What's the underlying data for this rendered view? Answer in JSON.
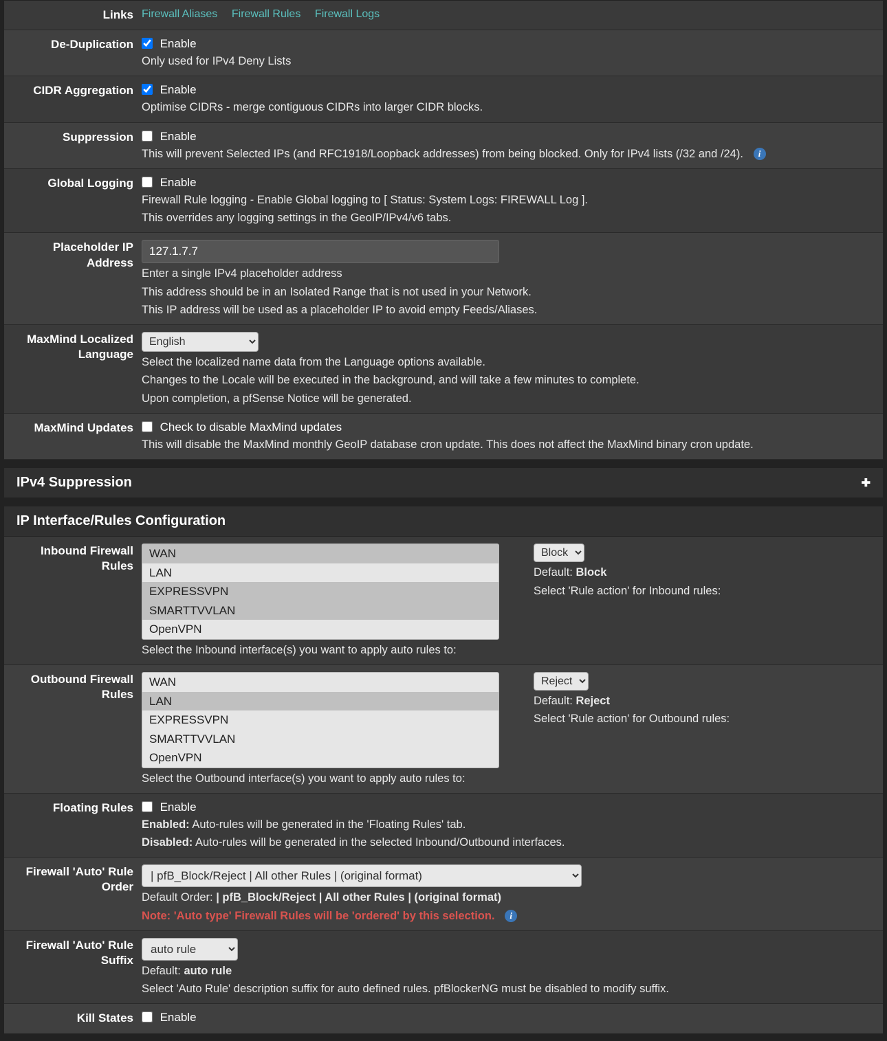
{
  "config": {
    "links": {
      "label": "Links",
      "items": [
        "Firewall Aliases",
        "Firewall Rules",
        "Firewall Logs"
      ]
    },
    "dedup": {
      "label": "De-Duplication",
      "enable": "Enable",
      "checked": true,
      "help": "Only used for IPv4 Deny Lists"
    },
    "cidr": {
      "label": "CIDR Aggregation",
      "enable": "Enable",
      "checked": true,
      "help": "Optimise CIDRs - merge contiguous CIDRs into larger CIDR blocks."
    },
    "suppression": {
      "label": "Suppression",
      "enable": "Enable",
      "checked": false,
      "help": "This will prevent Selected IPs (and RFC1918/Loopback addresses) from being blocked. Only for IPv4 lists (/32 and /24)."
    },
    "globallog": {
      "label": "Global Logging",
      "enable": "Enable",
      "checked": false,
      "help1": "Firewall Rule logging - Enable Global logging to [ Status: System Logs: FIREWALL Log ].",
      "help2": "This overrides any logging settings in the GeoIP/IPv4/v6 tabs."
    },
    "placeholder": {
      "label": "Placeholder IP Address",
      "value": "127.1.7.7",
      "help1": "Enter a single IPv4 placeholder address",
      "help2": "This address should be in an Isolated Range that is not used in your Network.",
      "help3": "This IP address will be used as a placeholder IP to avoid empty Feeds/Aliases."
    },
    "maxmindlang": {
      "label": "MaxMind Localized Language",
      "value": "English",
      "help1": "Select the localized name data from the Language options available.",
      "help2": "Changes to the Locale will be executed in the background, and will take a few minutes to complete.",
      "help3": "Upon completion, a pfSense Notice will be generated."
    },
    "maxmindupd": {
      "label": "MaxMind Updates",
      "enable": "Check to disable MaxMind updates",
      "checked": false,
      "help": "This will disable the MaxMind monthly GeoIP database cron update. This does not affect the MaxMind binary cron update."
    }
  },
  "ipv4supp": {
    "title": "IPv4 Suppression"
  },
  "iprules": {
    "title": "IP Interface/Rules Configuration",
    "inbound": {
      "label": "Inbound Firewall Rules",
      "options": [
        "WAN",
        "LAN",
        "EXPRESSVPN",
        "SMARTTVVLAN",
        "OpenVPN"
      ],
      "selected": [
        0,
        2,
        3
      ],
      "action": "Block",
      "default_prefix": "Default: ",
      "default": "Block",
      "help_action": "Select 'Rule action' for Inbound rules:",
      "help": "Select the Inbound interface(s) you want to apply auto rules to:"
    },
    "outbound": {
      "label": "Outbound Firewall Rules",
      "options": [
        "WAN",
        "LAN",
        "EXPRESSVPN",
        "SMARTTVVLAN",
        "OpenVPN"
      ],
      "selected": [
        1
      ],
      "action": "Reject",
      "default_prefix": "Default: ",
      "default": "Reject",
      "help_action": "Select 'Rule action' for Outbound rules:",
      "help": "Select the Outbound interface(s) you want to apply auto rules to:"
    },
    "floating": {
      "label": "Floating Rules",
      "enable": "Enable",
      "checked": false,
      "enabled_label": "Enabled:",
      "enabled_text": " Auto-rules will be generated in the 'Floating Rules' tab.",
      "disabled_label": "Disabled:",
      "disabled_text": " Auto-rules will be generated in the selected Inbound/Outbound interfaces."
    },
    "ruleorder": {
      "label": "Firewall 'Auto' Rule Order",
      "value": "| pfB_Block/Reject | All other Rules | (original format)",
      "default_prefix": "Default Order: ",
      "default": "| pfB_Block/Reject | All other Rules | (original format)",
      "note": "Note: 'Auto type' Firewall Rules will be 'ordered' by this selection."
    },
    "rulesuffix": {
      "label": "Firewall 'Auto' Rule Suffix",
      "value": "auto rule",
      "default_prefix": "Default: ",
      "default": "auto rule",
      "help": "Select 'Auto Rule' description suffix for auto defined rules. pfBlockerNG must be disabled to modify suffix."
    },
    "killstates": {
      "label": "Kill States",
      "enable": "Enable",
      "checked": false
    }
  }
}
